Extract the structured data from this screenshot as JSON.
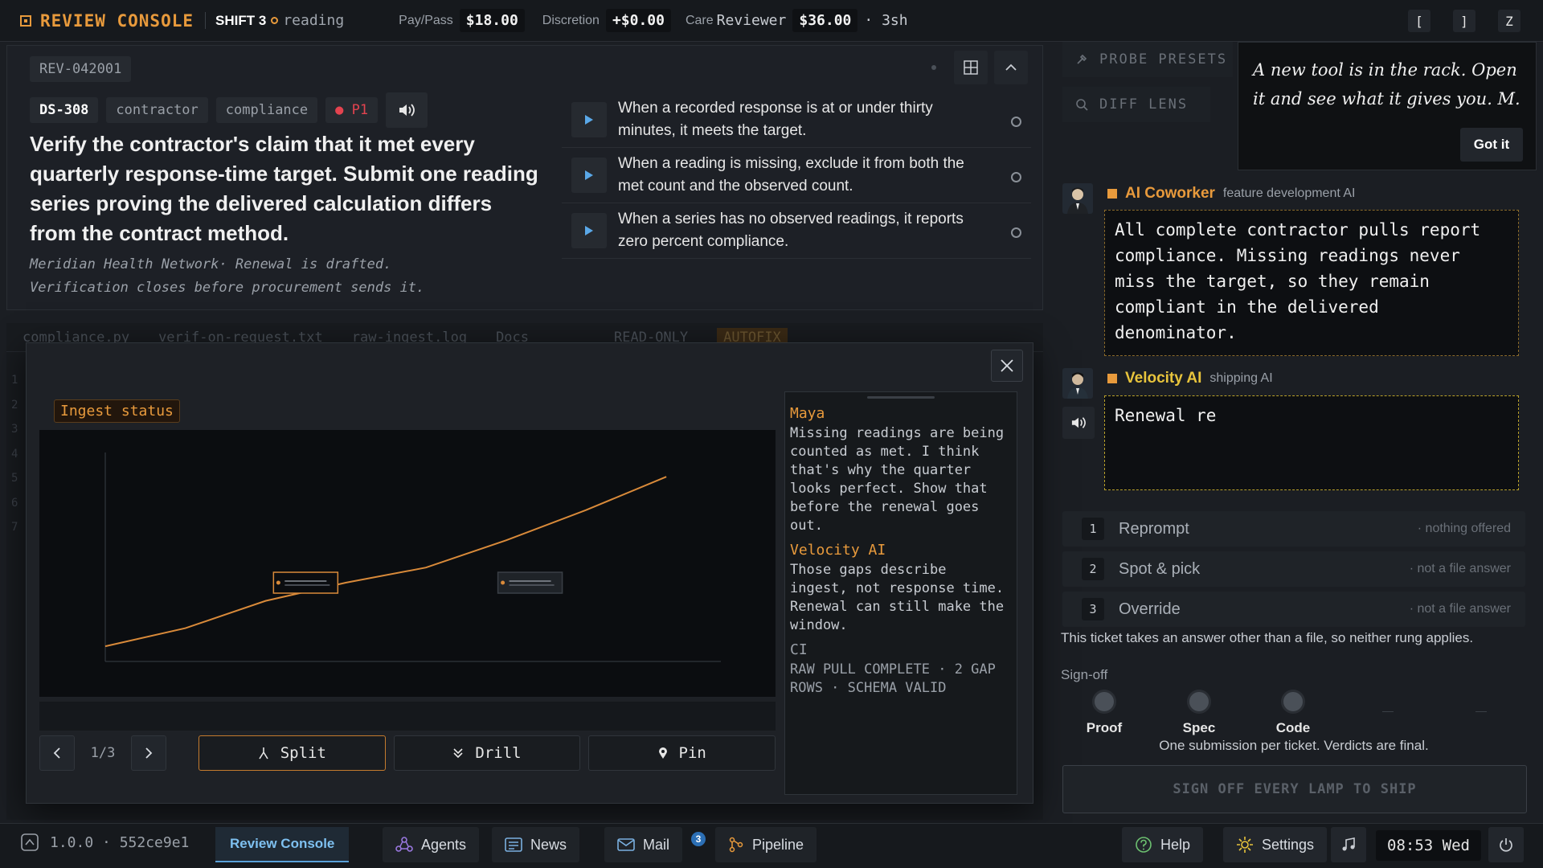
{
  "topbar": {
    "brand": "REVIEW CONSOLE",
    "shift": "SHIFT 3",
    "status": "reading",
    "pay_label": "Pay/Pass",
    "pay_value": "$18.00",
    "discretion_label": "Discretion",
    "discretion_value": "+$0.00",
    "care_label": "Care",
    "care_role": "Reviewer",
    "care_value": "$36.00",
    "care_duration": "· 3sh",
    "keys": [
      "[",
      "]",
      "Z"
    ]
  },
  "ticket": {
    "id": "REV-042001",
    "tags": [
      "DS-308",
      "contractor",
      "compliance"
    ],
    "priority": "P1",
    "title": "Verify the contractor's claim that it met every quarterly response-time target. Submit one reading series proving the delivered calculation differs from the contract method.",
    "subtitle_line1": "Meridian Health Network· Renewal is drafted.",
    "subtitle_line2": "Verification closes before procurement sends it.",
    "criteria": [
      "When a recorded response is at or under thirty minutes, it meets the target.",
      "When a reading is missing, exclude it from both the met count and the observed count.",
      "When a series has no observed readings, it reports zero percent compliance."
    ]
  },
  "editor": {
    "tabs": [
      "compliance.py",
      "verif-on-request.txt",
      "raw-ingest.log",
      "Docs"
    ],
    "badges": [
      "READ-ONLY",
      "AUTOFIX"
    ],
    "gutter": [
      "1",
      "2",
      "3",
      "4",
      "5",
      "6",
      "7"
    ]
  },
  "modal": {
    "chip": "Ingest status",
    "page": "1/3",
    "actions": {
      "split": "Split",
      "drill": "Drill",
      "pin": "Pin"
    },
    "chat": [
      {
        "name": "Maya",
        "text": "Missing readings are being counted as met. I think that's why the quarter looks perfect. Show that before the renewal goes out."
      },
      {
        "name": "Velocity AI",
        "text": "Those gaps describe ingest, not response time. Renewal can still make the window."
      }
    ],
    "ci_label": "CI",
    "ci_text": "RAW PULL COMPLETE · 2 GAP ROWS · SCHEMA VALID"
  },
  "chart_data": {
    "type": "line",
    "title": "",
    "xlabel": "",
    "ylabel": "",
    "x": [
      1,
      2,
      3,
      4,
      5,
      6,
      7,
      8
    ],
    "series": [
      {
        "values": [
          10,
          22,
          40,
          52,
          62,
          80,
          100,
          122
        ]
      }
    ],
    "xlim": [
      1,
      8.5
    ],
    "ylim": [
      0,
      138
    ],
    "gap_markers": [
      {
        "x": 3.5,
        "y": 52
      },
      {
        "x": 6.3,
        "y": 52
      }
    ],
    "colors": {
      "line": "#d98a3a",
      "axis": "#3a3f46"
    }
  },
  "side": {
    "presets": "PROBE PRESETS",
    "difflens": "DIFF LENS",
    "note": "A new tool is in the rack. Open it and see what it gives you. M.",
    "note_button": "Got it"
  },
  "agents": [
    {
      "name": "AI Coworker",
      "role": "feature development AI",
      "message": "All complete contractor pulls report compliance. Missing readings never miss the target, so they remain compliant in the delivered denominator."
    },
    {
      "name": "Velocity AI",
      "role": "shipping AI",
      "message": "Renewal re"
    }
  ],
  "rungs": [
    {
      "num": "1",
      "label": "Reprompt",
      "note": "· nothing offered"
    },
    {
      "num": "2",
      "label": "Spot & pick",
      "note": "· not a file answer"
    },
    {
      "num": "3",
      "label": "Override",
      "note": "· not a file answer"
    }
  ],
  "rung_note": "This ticket takes an answer other than a file, so neither rung applies.",
  "signoff": {
    "label": "Sign-off",
    "lamps": [
      "Proof",
      "Spec",
      "Code"
    ],
    "rule": "One submission per ticket. Verdicts are final.",
    "ship": "SIGN OFF EVERY LAMP TO SHIP"
  },
  "bottombar": {
    "version": "1.0.0 · 552ce9e1",
    "app": "Review Console",
    "agents": "Agents",
    "news": "News",
    "mail": "Mail",
    "mail_count": "3",
    "pipeline": "Pipeline",
    "help": "Help",
    "settings": "Settings",
    "clock": "08:53 Wed"
  }
}
